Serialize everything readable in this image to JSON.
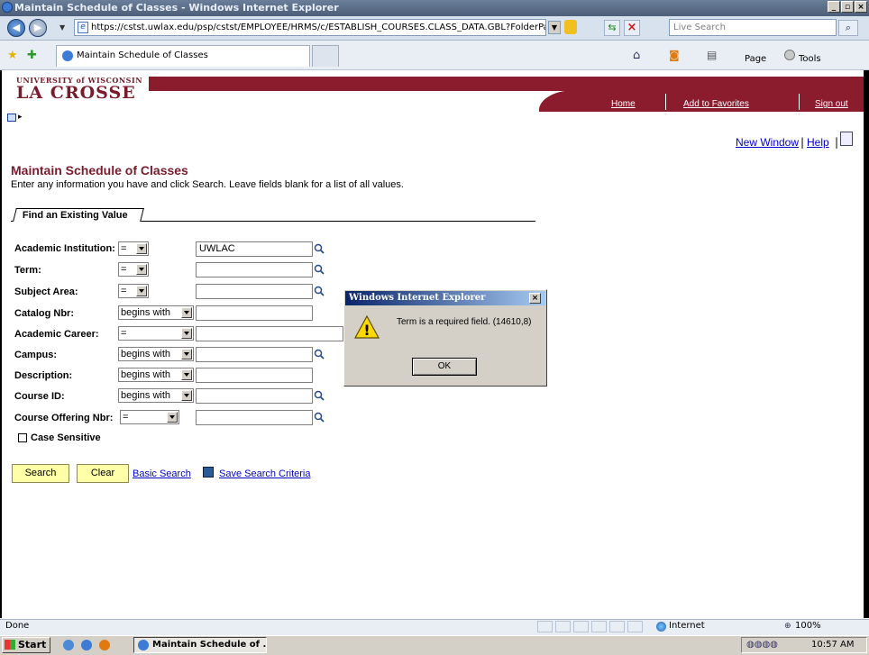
{
  "window": {
    "title": "Maintain Schedule of Classes - Windows Internet Explorer",
    "min": "_",
    "max": "▫",
    "close": "×"
  },
  "address_bar": {
    "url": "https://cstst.uwlax.edu/psp/cstst/EMPLOYEE/HRMS/c/ESTABLISH_COURSES.CLASS_DATA.GBL?FolderPath=PORTAL_R",
    "search_placeholder": "Live Search"
  },
  "tab_bar": {
    "tab_label": "Maintain Schedule of Classes",
    "page_menu": "Page",
    "tools_menu": "Tools"
  },
  "header": {
    "logo_top": "UNIVERSITY of WISCONSIN",
    "logo_main": "LA CROSSE",
    "links": {
      "home": "Home",
      "add_favorites": "Add to Favorites",
      "sign_out": "Sign out"
    }
  },
  "toplinks": {
    "new_window": "New Window",
    "help": "Help",
    "separator": "|"
  },
  "page": {
    "title": "Maintain Schedule of Classes",
    "instructions": "Enter any information you have and click Search. Leave fields blank for a list of all values.",
    "tab_label": "Find an Existing Value"
  },
  "fields": [
    {
      "label": "Academic Institution:",
      "operator": "=",
      "value": "UWLAC"
    },
    {
      "label": "Term:",
      "operator": "=",
      "value": ""
    },
    {
      "label": "Subject Area:",
      "operator": "=",
      "value": ""
    },
    {
      "label": "Catalog Nbr:",
      "operator": "begins with",
      "value": ""
    },
    {
      "label": "Academic Career:",
      "operator": "=",
      "value": ""
    },
    {
      "label": "Campus:",
      "operator": "begins with",
      "value": ""
    },
    {
      "label": "Description:",
      "operator": "begins with",
      "value": ""
    },
    {
      "label": "Course ID:",
      "operator": "begins with",
      "value": ""
    },
    {
      "label": "Course Offering Nbr:",
      "operator": "=",
      "value": ""
    }
  ],
  "case_sensitive_label": "Case Sensitive",
  "buttons": {
    "search": "Search",
    "clear": "Clear",
    "basic_search": "Basic Search",
    "save_criteria": "Save Search Criteria"
  },
  "dialog": {
    "title": "Windows Internet Explorer",
    "message": "Term is a required field. (14610,8)",
    "ok": "OK",
    "icon_glyph": "!"
  },
  "statusbar": {
    "status": "Done",
    "zone": "Internet",
    "zoom": "100%"
  },
  "taskbar": {
    "start": "Start",
    "task_item": "Maintain Schedule of ...",
    "clock": "10:57 AM"
  },
  "colors": {
    "brand_maroon": "#8a1c2e",
    "link_blue": "#0000cc",
    "button_yellow": "#ffffa8"
  }
}
